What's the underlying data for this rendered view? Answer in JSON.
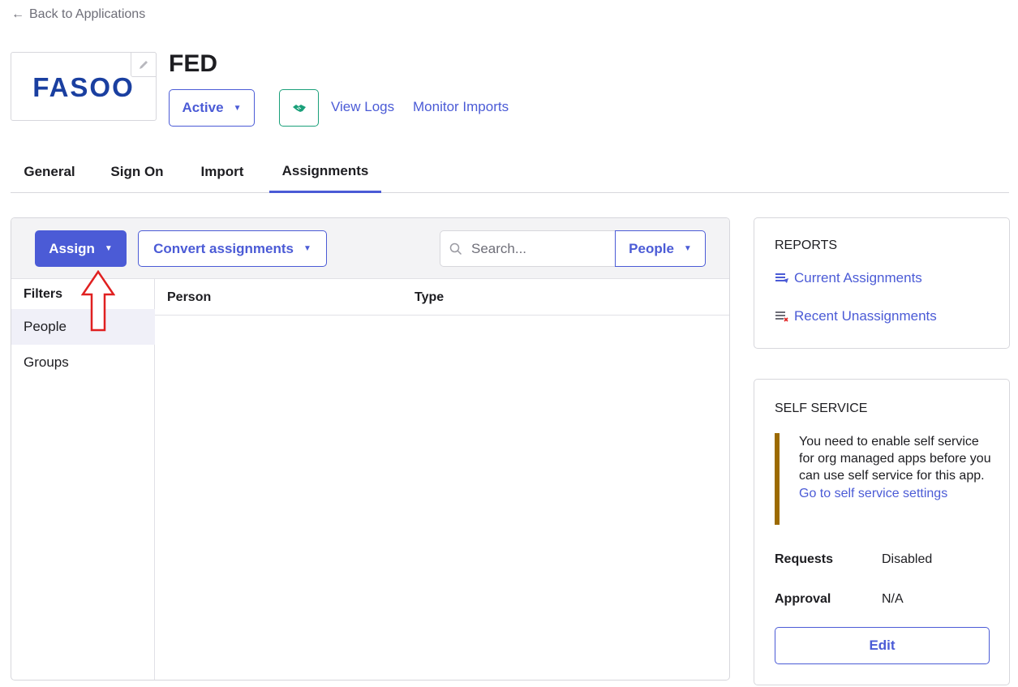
{
  "back_link": {
    "arrow": "←",
    "label": "Back to Applications"
  },
  "app": {
    "logo_text": "FASOO",
    "title": "FED",
    "status_label": "Active",
    "handshake_icon": "handshake-icon",
    "links": [
      "View Logs",
      "Monitor Imports"
    ]
  },
  "tabs": [
    {
      "label": "General",
      "active": false
    },
    {
      "label": "Sign On",
      "active": false
    },
    {
      "label": "Import",
      "active": false
    },
    {
      "label": "Assignments",
      "active": true
    }
  ],
  "toolbar": {
    "assign_label": "Assign",
    "convert_label": "Convert assignments",
    "search_placeholder": "Search...",
    "people_label": "People",
    "caret": "▼"
  },
  "filters": {
    "title": "Filters",
    "items": [
      {
        "label": "People",
        "selected": true
      },
      {
        "label": "Groups",
        "selected": false
      }
    ]
  },
  "table": {
    "columns": [
      "Person",
      "Type"
    ],
    "rows": []
  },
  "reports": {
    "title": "REPORTS",
    "links": [
      "Current Assignments",
      "Recent Unassignments"
    ]
  },
  "self_service": {
    "title": "SELF SERVICE",
    "notice": "You need to enable self service for org managed apps before you can use self service for this app.",
    "notice_link": "Go to self service settings",
    "requests_label": "Requests",
    "requests_value": "Disabled",
    "approval_label": "Approval",
    "approval_value": "N/A",
    "edit_label": "Edit"
  },
  "colors": {
    "accent": "#4b5bd6",
    "logo": "#1a3fa0",
    "success": "#1aa07a",
    "warning_bar": "#9c6a00",
    "annotation_arrow": "#e02020"
  }
}
